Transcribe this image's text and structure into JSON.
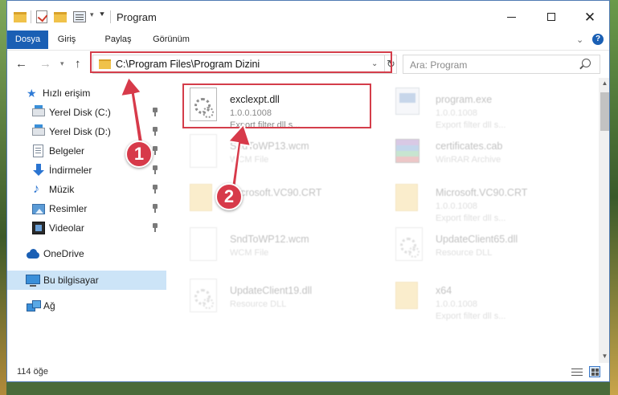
{
  "window": {
    "title": "Program"
  },
  "ribbon": {
    "tabs": [
      "Dosya",
      "Giriş",
      "Paylaş",
      "Görünüm"
    ]
  },
  "address": {
    "path": "C:\\Program Files\\Program Dizini",
    "search_placeholder": "Ara: Program"
  },
  "sidebar": {
    "items": [
      {
        "label": "Hızlı erişim",
        "icon": "star-icon"
      },
      {
        "label": "Yerel Disk (C:)",
        "icon": "disk-icon",
        "pinned": true
      },
      {
        "label": "Yerel Disk (D:)",
        "icon": "disk-icon",
        "pinned": true
      },
      {
        "label": "Belgeler",
        "icon": "document-icon",
        "pinned": true
      },
      {
        "label": "İndirmeler",
        "icon": "download-icon",
        "pinned": true
      },
      {
        "label": "Müzik",
        "icon": "music-icon",
        "pinned": true
      },
      {
        "label": "Resimler",
        "icon": "pictures-icon",
        "pinned": true
      },
      {
        "label": "Videolar",
        "icon": "video-icon",
        "pinned": true
      },
      {
        "label": "OneDrive",
        "icon": "cloud-icon"
      },
      {
        "label": "Bu bilgisayar",
        "icon": "computer-icon",
        "selected": true
      },
      {
        "label": "Ağ",
        "icon": "network-icon"
      }
    ]
  },
  "files": [
    {
      "name": "exclexpt.dll",
      "line1": "1.0.0.1008",
      "line2": "Export filter dll s...",
      "icon": "dll-icon",
      "highlighted": true
    },
    {
      "name": "program.exe",
      "line1": "1.0.0.1008",
      "line2": "Export filter dll s...",
      "icon": "exe-icon"
    },
    {
      "name": "SndToWP13.wcm",
      "line1": "WCM File",
      "line2": "",
      "icon": "page-icon"
    },
    {
      "name": "certificates.cab",
      "line1": "WinRAR Archive",
      "line2": "",
      "icon": "archive-icon"
    },
    {
      "name": "Microsoft.VC90.CRT",
      "line1": "",
      "line2": "",
      "icon": "folder-icon"
    },
    {
      "name": "Microsoft.VC90.CRT",
      "line1": "1.0.0.1008",
      "line2": "Export filter dll s...",
      "icon": "folder-icon"
    },
    {
      "name": "SndToWP12.wcm",
      "line1": "WCM File",
      "line2": "",
      "icon": "page-icon"
    },
    {
      "name": "UpdateClient65.dll",
      "line1": "Resource DLL",
      "line2": "",
      "icon": "dll-icon"
    },
    {
      "name": "UpdateClient19.dll",
      "line1": "Resource DLL",
      "line2": "",
      "icon": "dll-icon"
    },
    {
      "name": "x64",
      "line1": "1.0.0.1008",
      "line2": "Export filter dll s...",
      "icon": "folder-icon"
    }
  ],
  "status": {
    "count": "114 öğe"
  },
  "callouts": [
    "1",
    "2"
  ],
  "colors": {
    "accent": "#1a5fb4",
    "highlight": "#d43d4a",
    "selection": "#cce4f7"
  }
}
